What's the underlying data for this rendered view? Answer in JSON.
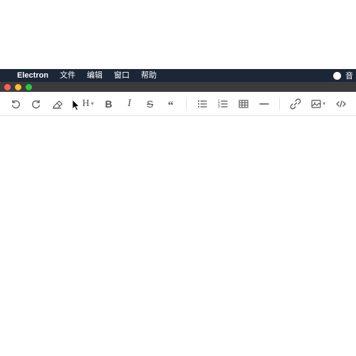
{
  "menubar": {
    "app_name": "Electron",
    "items": [
      "文件",
      "编辑",
      "窗口",
      "帮助"
    ],
    "status_right_text": "音"
  },
  "toolbar": {
    "heading_glyph": "H",
    "bold_glyph": "B",
    "italic_glyph": "I",
    "strike_glyph": "S",
    "quote_glyph": "“"
  }
}
